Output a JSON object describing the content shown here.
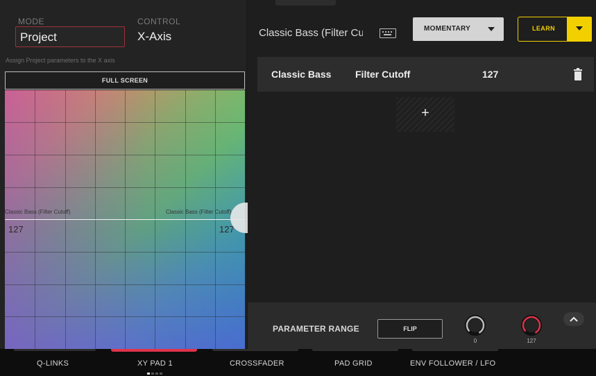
{
  "left": {
    "mode_label": "MODE",
    "mode_value": "Project",
    "control_label": "CONTROL",
    "control_value": "X-Axis",
    "hint": "Assign Project parameters to the X axis",
    "full_screen": "FULL SCREEN",
    "pad": {
      "left_label": "Classic Bass (Filter Cutoff)",
      "right_label": "Classic Bass (Filter Cutoff)",
      "left_value": "127",
      "right_value": "127"
    }
  },
  "right": {
    "target_name": "Classic Bass (Filter Cutoff)",
    "keyboard_icon": "keyboard-icon",
    "momentary": "MOMENTARY",
    "learn": "LEARN",
    "param_row": {
      "track": "Classic Bass",
      "param": "Filter Cutoff",
      "value": "127",
      "icon": "trash-icon"
    },
    "add": "+",
    "range": {
      "label": "PARAMETER RANGE",
      "flip": "FLIP",
      "min": "0",
      "max": "127"
    }
  },
  "nav": {
    "items": [
      "Q-LINKS",
      "XY PAD 1",
      "CROSSFADER",
      "PAD GRID",
      "ENV FOLLOWER / LFO"
    ],
    "active_index": 1
  },
  "colors": {
    "accent_red": "#e0334a",
    "learn_yellow": "#f2d000"
  }
}
